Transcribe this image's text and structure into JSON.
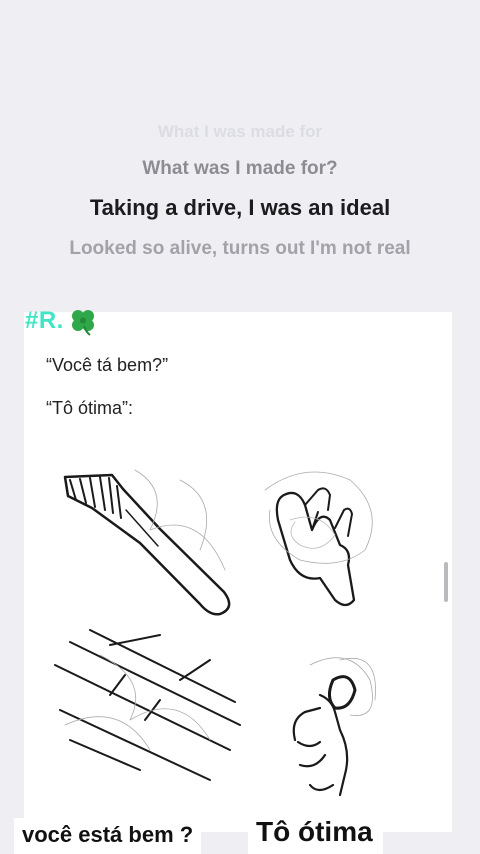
{
  "lyrics": {
    "faded": "What I was made for",
    "previous": "What was I made for?",
    "current": "Taking a drive, I was an ideal",
    "next": "Looked so alive, turns out I'm not real"
  },
  "post": {
    "tag": "#R.",
    "tag_icon": "four-leaf-clover-icon",
    "tag_color": "#3fe6c6",
    "question": "“Você tá bem?”",
    "answer": "“Tô ótima”:",
    "illustrations": [
      "comb-icon",
      "hand-with-hair-icon",
      "floor-tiles-with-hair-icon",
      "hand-holding-hair-icon"
    ]
  },
  "captions": {
    "left": "você está bem ?",
    "right": "Tô ótima"
  }
}
